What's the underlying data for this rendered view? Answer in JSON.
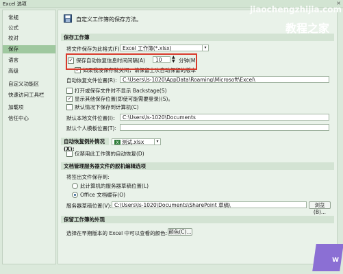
{
  "window": {
    "title": "Excel 选项",
    "close_glyph": "×"
  },
  "sidebar": {
    "items": [
      {
        "label": "常规"
      },
      {
        "label": "公式"
      },
      {
        "label": "校对"
      },
      {
        "label": "保存"
      },
      {
        "label": "语言"
      },
      {
        "label": "高级"
      },
      {
        "label": "自定义功能区"
      },
      {
        "label": "快速访问工具栏"
      },
      {
        "label": "加载项"
      },
      {
        "label": "信任中心"
      }
    ],
    "selected": "保存"
  },
  "intro": "自定义工作簿的保存方法。",
  "sections": {
    "save": "保存工作簿",
    "autorecover_except": "自动恢复例外情况(X):",
    "offline": "文档管理服务器文件的脱机编辑选项",
    "appearance": "保留工作簿的外观"
  },
  "save": {
    "format_label": "将文件保存为此格式(F):",
    "format_value": "Excel 工作簿(*.xlsx)",
    "autorecover_label": "保存自动恢复信息时间间隔(A)",
    "autorecover_value": "10",
    "minutes": "分钟(M)",
    "keep_last": "如果我没保存就关闭，请保留上次自动保留的版本",
    "autorecover_loc_label": "自动恢复文件位置(R):",
    "autorecover_loc_value": "C:\\Users\\ls-1020\\AppData\\Roaming\\Microsoft\\Excel\\",
    "no_backstage": "打开或保存文件时不显示 Backstage(S)",
    "show_other": "显示其他保存位置(即使可能需要登录)(S)。",
    "default_local": "默认情况下保存到计算机(C)",
    "default_local_loc_label": "默认本地文件位置(I):",
    "default_local_loc_value": "C:\\Users\\ls-1020\\Documents",
    "personal_templates_label": "默认个人模板位置(T):",
    "personal_templates_value": ""
  },
  "except": {
    "workbook": "测试.xlsx",
    "disable": "仅禁用此工作簿的自动恢复(D)"
  },
  "offline": {
    "save_to": "将签出文件保存到:",
    "opt_server": "此计算机的服务器草稿位置(L)",
    "opt_office": "Office 文档缓存(O)",
    "server_drafts_label": "服务器草稿位置(V):",
    "server_drafts_value": "C:\\Users\\ls-1020\\Documents\\SharePoint 草稿\\",
    "browse": "浏览(B)..."
  },
  "appearance": {
    "colors_label": "选择在早期版本的 Excel 中可以查看的颜色:",
    "colors_button": "颜色(C)..."
  },
  "watermark": {
    "url": "jiaochengzhijia.com",
    "name": "教程之家",
    "corner_text": "W"
  }
}
